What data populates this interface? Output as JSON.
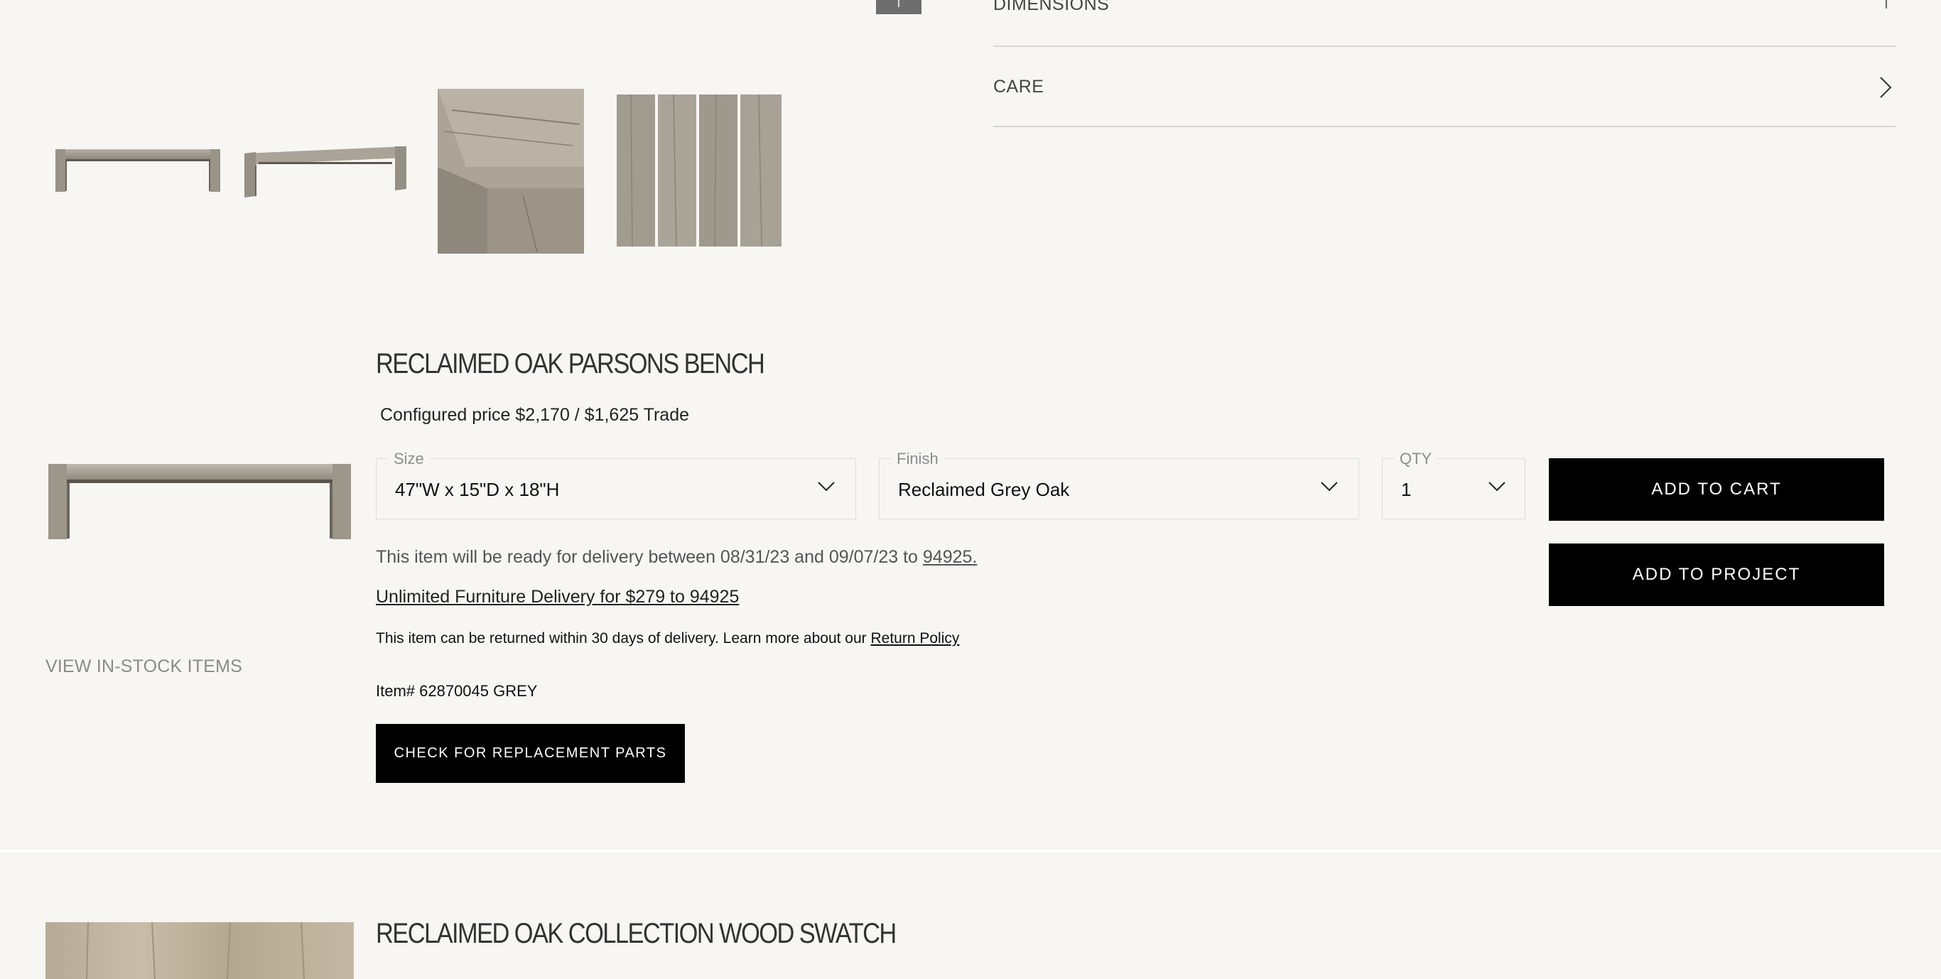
{
  "accordion": {
    "dimensions_label": "DIMENSIONS",
    "care_label": "CARE"
  },
  "thumbnails": [
    {
      "name": "bench-front-thumbnail"
    },
    {
      "name": "bench-angle-thumbnail"
    },
    {
      "name": "bench-corner-detail-thumbnail"
    },
    {
      "name": "wood-planks-thumbnail"
    }
  ],
  "product": {
    "title": "RECLAIMED OAK PARSONS BENCH",
    "configured_price": "Configured price $2,170 / $1,625 Trade",
    "size": {
      "legend": "Size",
      "value": "47\"W x 15\"D x 18\"H"
    },
    "finish": {
      "legend": "Finish",
      "value": "Reclaimed Grey Oak"
    },
    "qty": {
      "legend": "QTY",
      "value": "1"
    },
    "add_to_cart_label": "ADD TO CART",
    "add_to_project_label": "ADD TO PROJECT",
    "delivery_text": "This item will be ready for delivery between 08/31/23 and 09/07/23 to ",
    "delivery_zip": "94925.",
    "unlimited_delivery_link": "Unlimited Furniture Delivery for $279 to 94925",
    "return_text": "This item can be returned within 30 days of delivery. Learn more about our ",
    "return_policy_link": "Return Policy",
    "item_number": "Item# 62870045 GREY",
    "replacement_parts_label": "CHECK FOR REPLACEMENT PARTS",
    "view_instock_label": "VIEW IN-STOCK ITEMS"
  },
  "swatch": {
    "title": "RECLAIMED OAK COLLECTION WOOD SWATCH"
  },
  "icons": {
    "dimensions": "plus-icon",
    "care": "chevron-right-icon",
    "select": "chevron-down-icon"
  },
  "colors": {
    "background": "#f7f6f3",
    "button": "#000000",
    "button_text": "#ffffff",
    "divider": "#d8d6d1"
  }
}
